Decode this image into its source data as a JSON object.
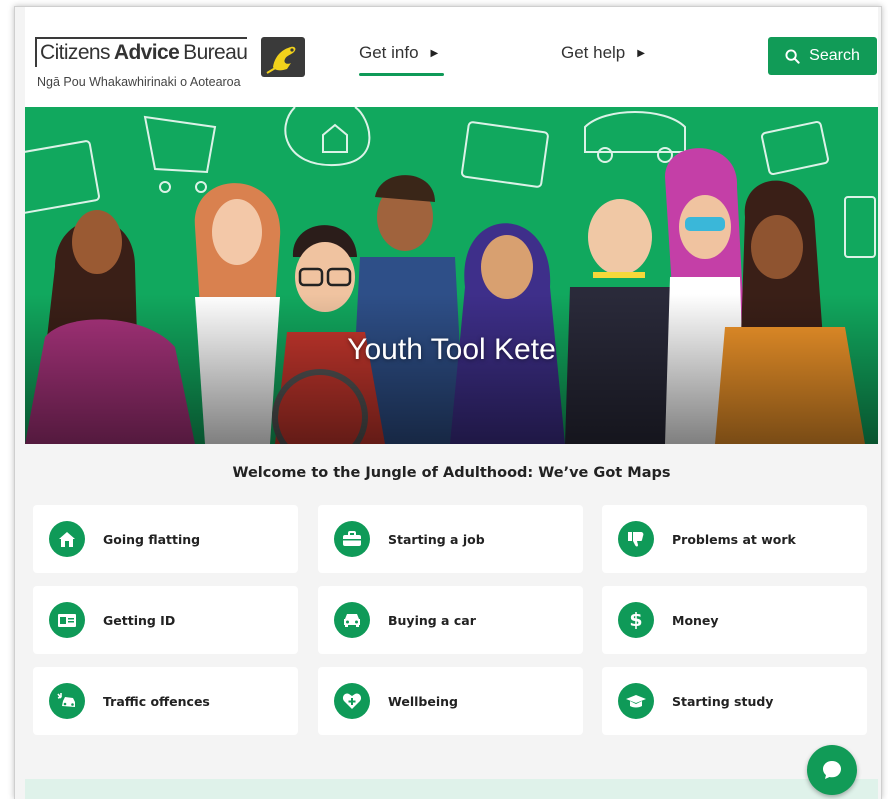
{
  "header": {
    "logo_main_a": "Citizens",
    "logo_main_b": "Advice",
    "logo_main_c": "Bureau",
    "logo_sub": "Ngā Pou Whakawhirinaki o Aotearoa",
    "nav": [
      {
        "label": "Get info",
        "active": true
      },
      {
        "label": "Get help",
        "active": false
      }
    ],
    "search_label": "Search"
  },
  "hero": {
    "title": "Youth Tool Kete"
  },
  "welcome": "Welcome to the Jungle of Adulthood: We’ve Got Maps",
  "topics": [
    {
      "label": "Going flatting",
      "icon": "house-icon"
    },
    {
      "label": "Starting a job",
      "icon": "briefcase-icon"
    },
    {
      "label": "Problems at work",
      "icon": "thumbs-down-icon"
    },
    {
      "label": "Getting ID",
      "icon": "id-card-icon"
    },
    {
      "label": "Buying a car",
      "icon": "car-icon"
    },
    {
      "label": "Money",
      "icon": "dollar-icon"
    },
    {
      "label": "Traffic offences",
      "icon": "car-crash-icon"
    },
    {
      "label": "Wellbeing",
      "icon": "heart-plus-icon"
    },
    {
      "label": "Starting study",
      "icon": "graduation-cap-icon"
    }
  ],
  "colors": {
    "brand_green": "#119b57",
    "hero_green": "#11a85e",
    "page_bg": "#f4f4f4"
  }
}
